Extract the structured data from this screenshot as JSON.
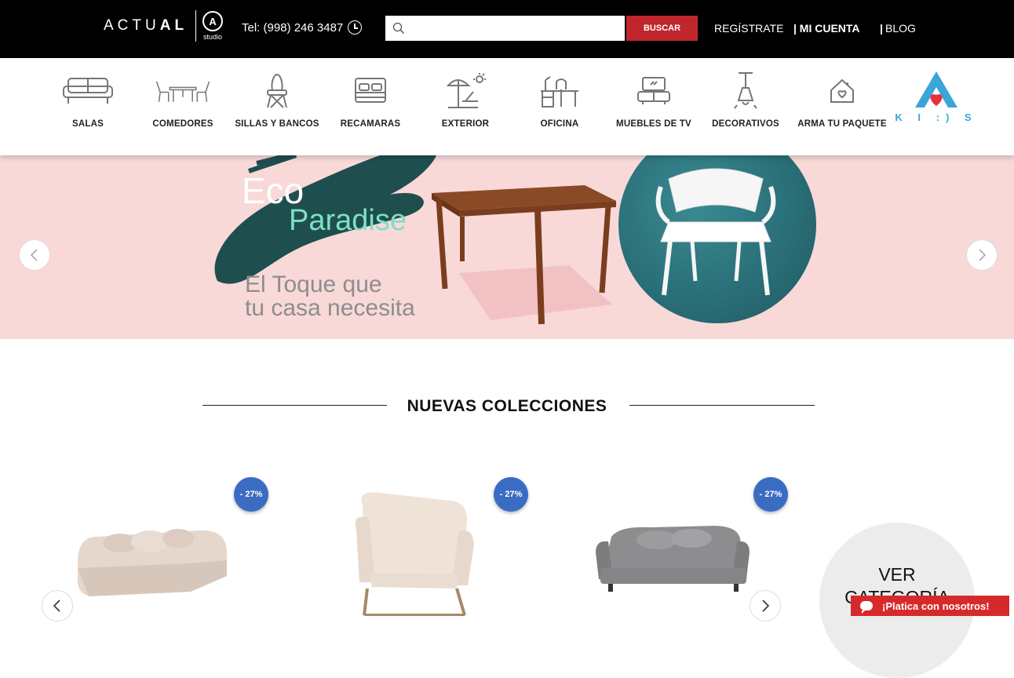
{
  "header": {
    "logo": {
      "word_light": "ACTU",
      "word_bold": "AL",
      "mark": "A",
      "sub": "studio"
    },
    "phone": "Tel: (998) 246 3487",
    "search": {
      "placeholder": "",
      "button": "BUSCAR"
    },
    "links": {
      "register": "REGÍSTRATE",
      "account": "| MI CUENTA",
      "blog_sep": "|",
      "blog": "BLOG"
    },
    "colors": {
      "bar": "#000000",
      "button": "#c0272d"
    }
  },
  "nav": {
    "items": [
      {
        "label": "SALAS",
        "icon": "sofa-icon"
      },
      {
        "label": "COMEDORES",
        "icon": "dining-table-icon"
      },
      {
        "label": "SILLAS Y BANCOS",
        "icon": "chair-icon"
      },
      {
        "label": "RECAMARAS",
        "icon": "bed-icon"
      },
      {
        "label": "EXTERIOR",
        "icon": "sun-lounger-icon"
      },
      {
        "label": "OFICINA",
        "icon": "desk-icon"
      },
      {
        "label": "MUEBLES DE TV",
        "icon": "tv-unit-icon"
      },
      {
        "label": "DECORATIVOS",
        "icon": "pendant-lamp-icon"
      },
      {
        "label": "ARMA TU PAQUETE",
        "icon": "house-heart-icon"
      }
    ],
    "kids": {
      "label": "K I :) S",
      "icon": "kids-logo-icon"
    }
  },
  "banner": {
    "line1": "Eco",
    "line2": "Paradise",
    "tagline1": "El Toque que",
    "tagline2": "tu casa necesita",
    "colors": {
      "background": "#f8d9d8",
      "accent": "#7fe0c4",
      "circle": "#2a6f78"
    }
  },
  "collections": {
    "title": "NUEVAS COLECCIONES",
    "products": [
      {
        "badge": "- 27%",
        "image": "sectional-sofa"
      },
      {
        "badge": "- 27%",
        "image": "armchair"
      },
      {
        "badge": "- 27%",
        "image": "grey-sofa"
      }
    ],
    "ver_line1": "VER",
    "ver_line2": "CATEGORÍA",
    "badge_color": "#3b6cc4"
  },
  "chat": {
    "label": "¡Platica con nosotros!",
    "color": "#d62a2a"
  }
}
